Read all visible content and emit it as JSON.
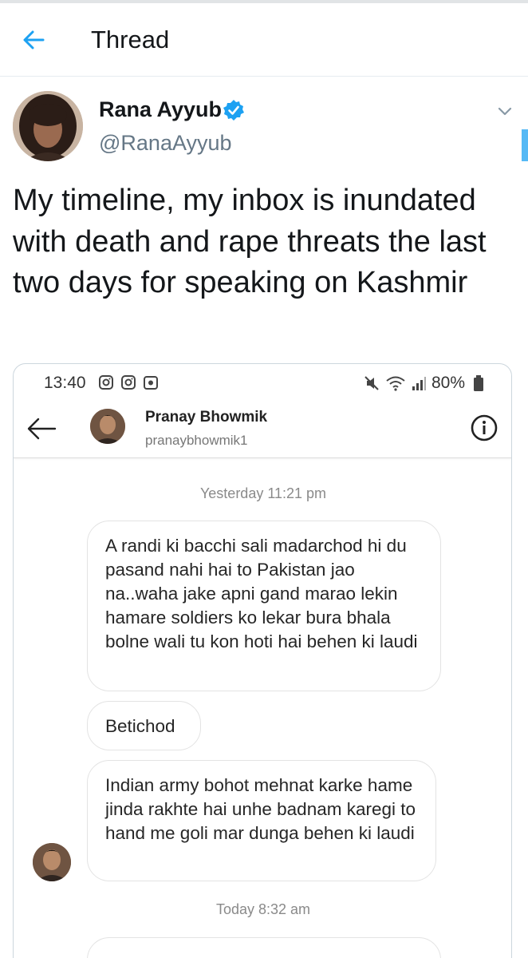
{
  "header": {
    "title": "Thread"
  },
  "tweet": {
    "author_name": "Rana Ayyub",
    "author_handle": "@RanaAyyub",
    "text": "My timeline, my inbox is inundated with death and rape threats the last two days for speaking on Kashmir"
  },
  "screenshot": {
    "status_bar": {
      "time": "13:40",
      "battery": "80%"
    },
    "dm_header": {
      "name": "Pranay Bhowmik",
      "username": "pranaybhowmik1"
    },
    "messages": {
      "timestamp_1": "Yesterday 11:21 pm",
      "msg_1": "A randi ki bacchi sali madarchod hi du pasand nahi hai to Pakistan jao na..waha jake apni gand marao lekin hamare soldiers ko lekar bura bhala bolne wali tu kon hoti hai behen ki laudi",
      "msg_2": "Betichod",
      "msg_3": "Indian army bohot mehnat karke hame jinda rakhte hai unhe badnam karegi to hand me goli mar dunga behen ki laudi",
      "timestamp_2": "Today 8:32 am"
    }
  },
  "colors": {
    "accent": "#1da1f2",
    "verified": "#1da1f2",
    "text": "#14171a",
    "secondary": "#657786"
  },
  "icons": [
    "back-arrow-icon",
    "verified-badge-icon",
    "chevron-down-icon",
    "instagram-icon",
    "wifi-icon",
    "signal-icon",
    "battery-icon",
    "mute-icon",
    "info-icon"
  ]
}
